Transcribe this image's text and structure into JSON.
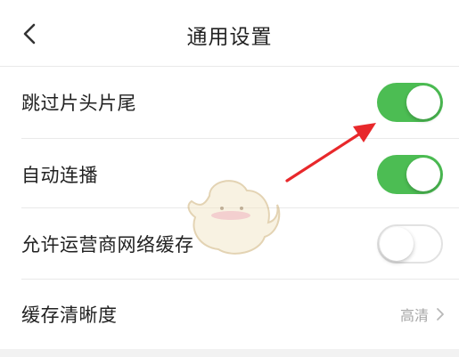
{
  "header": {
    "title": "通用设置",
    "back_icon": "chevron-left-icon"
  },
  "settings": [
    {
      "label": "跳过片头片尾",
      "control": "toggle",
      "enabled": true
    },
    {
      "label": "自动连播",
      "control": "toggle",
      "enabled": true
    },
    {
      "label": "允许运营商网络缓存",
      "control": "toggle",
      "enabled": false
    },
    {
      "label": "缓存清晰度",
      "control": "select",
      "value": "高清",
      "icon": "chevron-right-icon"
    }
  ],
  "colors": {
    "toggle_on": "#4cbd53",
    "toggle_off_border": "#e2e2e2",
    "annotation_arrow": "#e8282b"
  }
}
